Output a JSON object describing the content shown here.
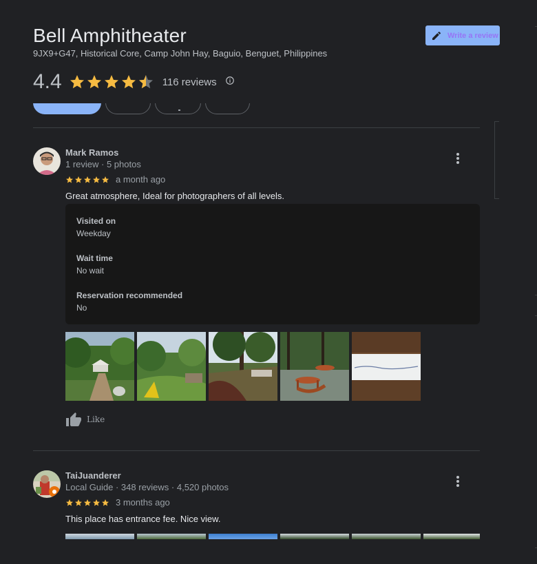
{
  "place": {
    "title": "Bell Amphitheater",
    "address": "9JX9+G47, Historical Core, Camp John Hay, Baguio, Benguet, Philippines",
    "rating": "4.4",
    "rating_fraction": 0.88,
    "review_count": "116 reviews",
    "write_review_label": "Write a review"
  },
  "colors": {
    "background": "#202124",
    "accent": "#8ab4f8",
    "star": "#f6bb42",
    "star_empty": "#70757a"
  },
  "icons": {
    "write": "pencil-icon",
    "info": "info-icon",
    "more": "more-vert-icon",
    "like": "thumb-up-icon"
  },
  "reviews": [
    {
      "name": "Mark Ramos",
      "meta": "1 review · 5 photos",
      "stars": 5,
      "date": "a month ago",
      "text": "Great atmosphere, Ideal for photographers of all levels.",
      "details": [
        {
          "label": "Visited on",
          "value": "Weekday"
        },
        {
          "label": "Wait time",
          "value": "No wait"
        },
        {
          "label": "Reservation recommended",
          "value": "No"
        }
      ],
      "photo_count": 5,
      "like_label": "Like"
    },
    {
      "name": "TaiJuanderer",
      "meta": "Local Guide · 348 reviews · 4,520 photos",
      "stars": 5,
      "date": "3 months ago",
      "text": "This place has entrance fee. Nice view."
    }
  ]
}
